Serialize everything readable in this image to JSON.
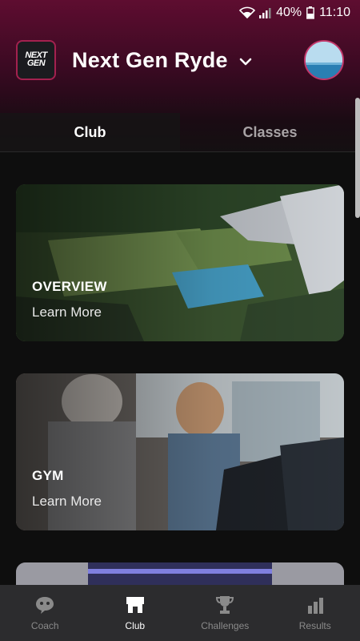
{
  "status_bar": {
    "battery": "40%",
    "time": "11:10",
    "icons": [
      "wifi-icon",
      "signal-icon",
      "battery-icon"
    ]
  },
  "header": {
    "logo_text": [
      "NEXT",
      "GEN"
    ],
    "club_name": "Next Gen Ryde",
    "chevron_icon": "chevron-down-icon",
    "avatar_icon": "avatar"
  },
  "tabs": [
    {
      "label": "Club",
      "active": true
    },
    {
      "label": "Classes",
      "active": false
    }
  ],
  "cards": [
    {
      "title": "OVERVIEW",
      "link": "Learn More"
    },
    {
      "title": "GYM",
      "link": "Learn More"
    }
  ],
  "bottom_nav": [
    {
      "label": "Coach",
      "icon": "chat-icon",
      "active": false
    },
    {
      "label": "Club",
      "icon": "storefront-icon",
      "active": true
    },
    {
      "label": "Challenges",
      "icon": "trophy-icon",
      "active": false
    },
    {
      "label": "Results",
      "icon": "bar-chart-icon",
      "active": false
    }
  ],
  "colors": {
    "accent": "#a3214f",
    "header_top": "#5e0d30",
    "background": "#0e0e0e",
    "nav_bg": "#2c2c2e"
  }
}
